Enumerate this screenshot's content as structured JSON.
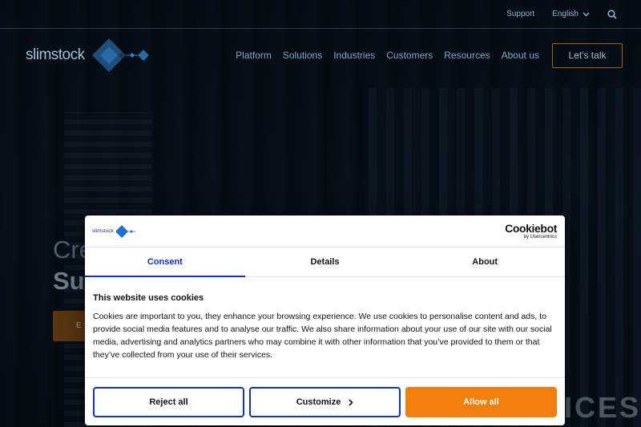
{
  "topbar": {
    "support": "Support",
    "language": "English"
  },
  "header": {
    "logo_text": "slimstock",
    "nav": [
      "Platform",
      "Solutions",
      "Industries",
      "Customers",
      "Resources",
      "About us"
    ],
    "cta": "Let's talk"
  },
  "hero": {
    "line1": "Cre",
    "line2": "Su",
    "button": "E",
    "building_sign": "ICES"
  },
  "cookie_dialog": {
    "logo_text": "slimstock",
    "provider_name": "Cookiebot",
    "provider_by": "by Usercentrics",
    "tabs": [
      "Consent",
      "Details",
      "About"
    ],
    "active_tab": "Consent",
    "title": "This website uses cookies",
    "body": "Cookies are important to you, they enhance your browsing experience. We use cookies to personalise content and ads, to provide social media features and to analyse our traffic. We also share information about your use of our site with our social media, advertising and analytics partners who may combine it with other information that you’ve provided to them or that they’ve collected from your use of their services.",
    "buttons": {
      "reject": "Reject all",
      "customize": "Customize",
      "allow": "Allow all"
    }
  },
  "colors": {
    "accent_blue": "#1032cf",
    "allow_orange": "#f27f0c",
    "cta_border": "#a4611b"
  }
}
